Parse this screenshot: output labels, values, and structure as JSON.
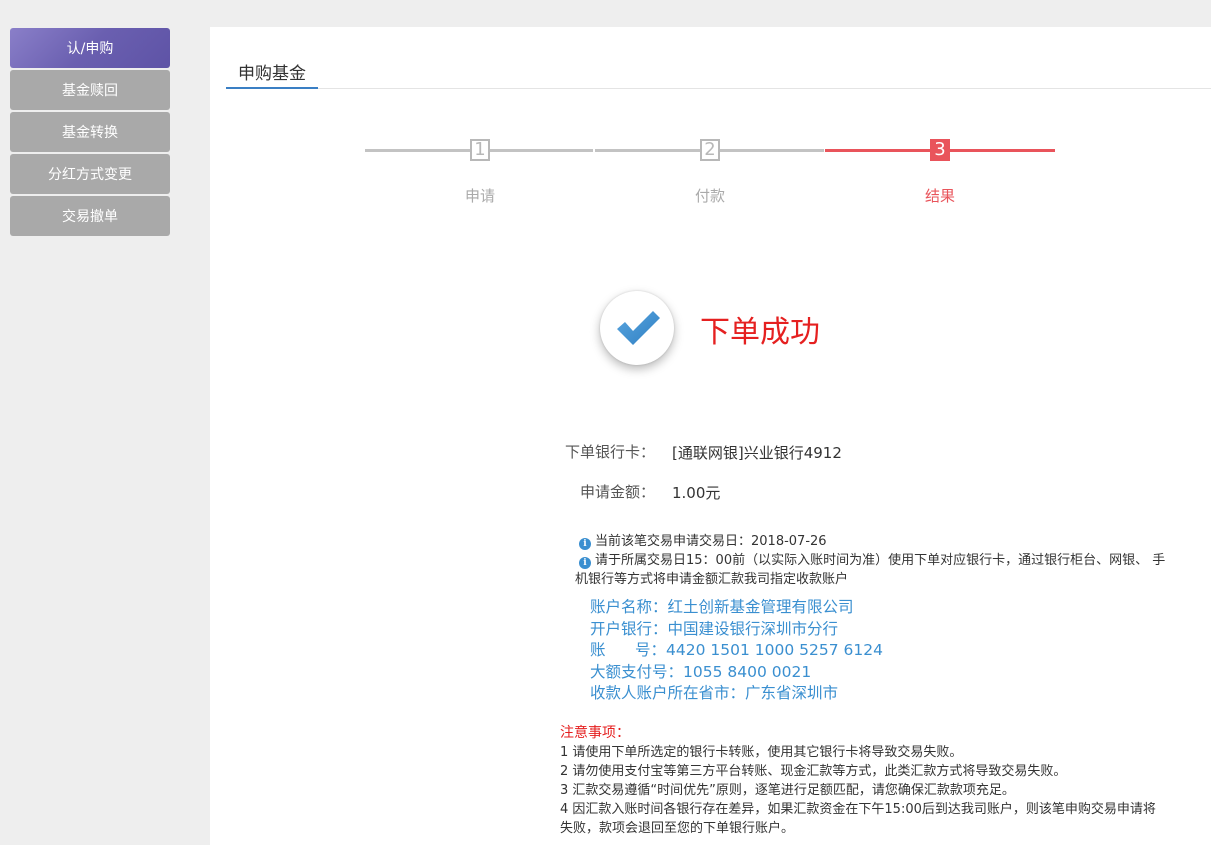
{
  "sidebar": {
    "items": [
      {
        "label": "认/申购",
        "active": true
      },
      {
        "label": "基金赎回"
      },
      {
        "label": "基金转换"
      },
      {
        "label": "分红方式变更"
      },
      {
        "label": "交易撤单"
      }
    ]
  },
  "tab": {
    "label": "申购基金"
  },
  "steps": [
    {
      "num": "1",
      "label": "申请"
    },
    {
      "num": "2",
      "label": "付款"
    },
    {
      "num": "3",
      "label": "结果",
      "active": true
    }
  ],
  "result": {
    "title": "下单成功"
  },
  "info": {
    "bank_card_label": "下单银行卡：",
    "bank_card_value": "[通联网银]兴业银行4912",
    "amount_label": "申请金额：",
    "amount_value": "1.00元"
  },
  "notes": {
    "line1": "当前该笔交易申请交易日：2018-07-26",
    "line2a": "请于所属交易日15：00前（以实际入账时间为准）使用下单对应银行卡，通过银行柜台、网银、 手",
    "line2b": "机银行等方式将申请金额汇款我司指定收款账户"
  },
  "account": {
    "name": "账户名称：红土创新基金管理有限公司",
    "bank": "开户银行：中国建设银行深圳市分行",
    "number": "账      号：4420 1501 1000 5257 6124",
    "large_pay": "大额支付号：1055 8400 0021",
    "province": "收款人账户所在省市：广东省深圳市"
  },
  "attention": {
    "title": "注意事项：",
    "items": [
      "1 请使用下单所选定的银行卡转账，使用其它银行卡将导致交易失败。",
      "2 请勿使用支付宝等第三方平台转账、现金汇款等方式，此类汇款方式将导致交易失败。",
      "3 汇款交易遵循“时间优先”原则，逐笔进行足额匹配，请您确保汇款款项充足。",
      "4 因汇款入账时间各银行存在差异，如果汇款资金在下午15:00后到达我司账户，则该笔申购交易申请将",
      "失败，款项会退回至您的下单银行账户。"
    ]
  },
  "colors": {
    "accent": "#e9545b",
    "link": "#3a8fd0",
    "active_nav": "#6a5fb0",
    "tab_underline": "#3a7fc4"
  }
}
